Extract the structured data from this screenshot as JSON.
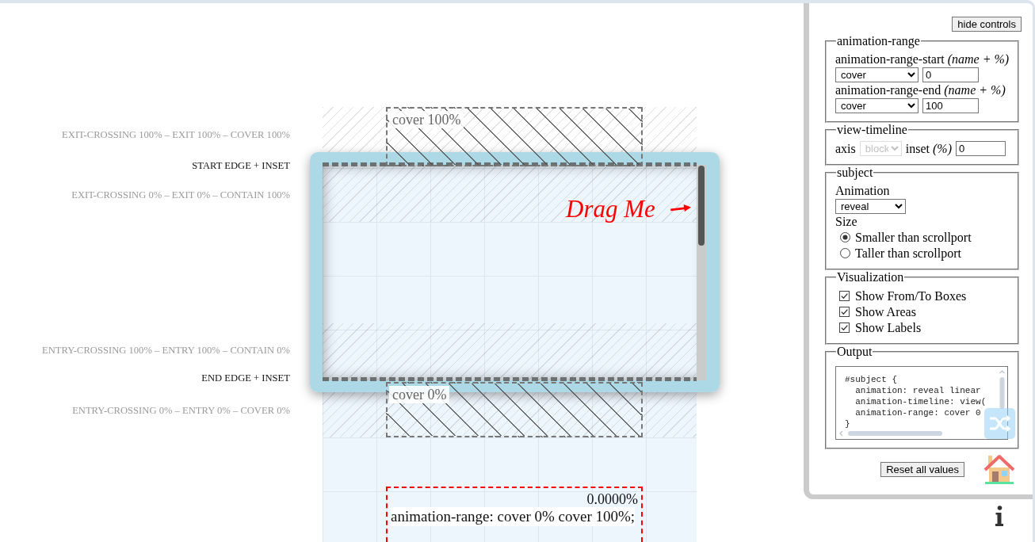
{
  "canvas": {
    "labels": [
      {
        "text": "EXIT-CROSSING 100% – EXIT 100% – COVER 100%",
        "kind": "range"
      },
      {
        "text": "START EDGE + INSET",
        "kind": "edge"
      },
      {
        "text": "EXIT-CROSSING 0% – EXIT 0% – CONTAIN 100%",
        "kind": "range"
      },
      {
        "text": "ENTRY-CROSSING 100% – ENTRY 100% – CONTAIN 0%",
        "kind": "range"
      },
      {
        "text": "END EDGE + INSET",
        "kind": "edge"
      },
      {
        "text": "ENTRY-CROSSING 0% – ENTRY 0% – COVER 0%",
        "kind": "range"
      }
    ],
    "range_boxes": [
      {
        "label": "cover 100%",
        "kind": "to"
      },
      {
        "label": "cover 0%",
        "kind": "from"
      }
    ],
    "drag_hint": "Drag Me",
    "subject": {
      "progress": "0.0000%",
      "declaration": "animation-range: cover 0% cover 100%;"
    }
  },
  "controls": {
    "hide_button": "hide controls",
    "animation_range": {
      "legend": "animation-range",
      "start": {
        "label": "animation-range-start *(name + %)*",
        "name": "cover",
        "percent": "0"
      },
      "end": {
        "label": "animation-range-end *(name + %)*",
        "name": "cover",
        "percent": "100"
      }
    },
    "view_timeline": {
      "legend": "view-timeline",
      "axis_label": "axis",
      "axis": {
        "value": "block",
        "disabled": true
      },
      "inset_label": "inset *(%)*",
      "inset": "0"
    },
    "subject": {
      "legend": "subject",
      "animation_label": "Animation",
      "animation": "reveal",
      "size_label": "Size",
      "sizes": [
        {
          "label": "Smaller than scrollport",
          "selected": true
        },
        {
          "label": "Taller than scrollport",
          "selected": false
        }
      ]
    },
    "visualization": {
      "legend": "Visualization",
      "options": [
        {
          "label": "Show From/To Boxes",
          "checked": true
        },
        {
          "label": "Show Areas",
          "checked": true
        },
        {
          "label": "Show Labels",
          "checked": true
        }
      ]
    },
    "output": {
      "legend": "Output",
      "code": [
        "#subject {",
        "  animation: reveal linear",
        "  animation-timeline: view(",
        "  animation-range: cover 0",
        "}"
      ]
    },
    "reset_button": "Reset all values"
  }
}
